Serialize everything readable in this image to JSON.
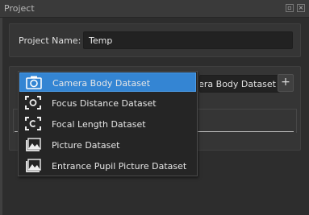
{
  "window": {
    "title": "Project",
    "float_glyph": "▫",
    "close_glyph": "×"
  },
  "project": {
    "name_label": "Project Name:",
    "name_value": "Temp"
  },
  "dataset_selector": {
    "selected_text": "Camera Body Dataset",
    "add_label": "+"
  },
  "dropdown": {
    "items": [
      {
        "label": "Camera Body Dataset",
        "icon": "camera-icon",
        "selected": true
      },
      {
        "label": "Focus Distance Dataset",
        "icon": "focus-frame-icon",
        "selected": false
      },
      {
        "label": "Focal Length Dataset",
        "icon": "focal-frame-icon",
        "selected": false
      },
      {
        "label": "Picture Dataset",
        "icon": "picture-icon",
        "selected": false
      },
      {
        "label": "Entrance Pupil Picture Dataset",
        "icon": "picture-icon",
        "selected": false
      }
    ]
  },
  "colors": {
    "accent": "#3485d3",
    "background": "#2d2d2d",
    "field": "#222222"
  }
}
